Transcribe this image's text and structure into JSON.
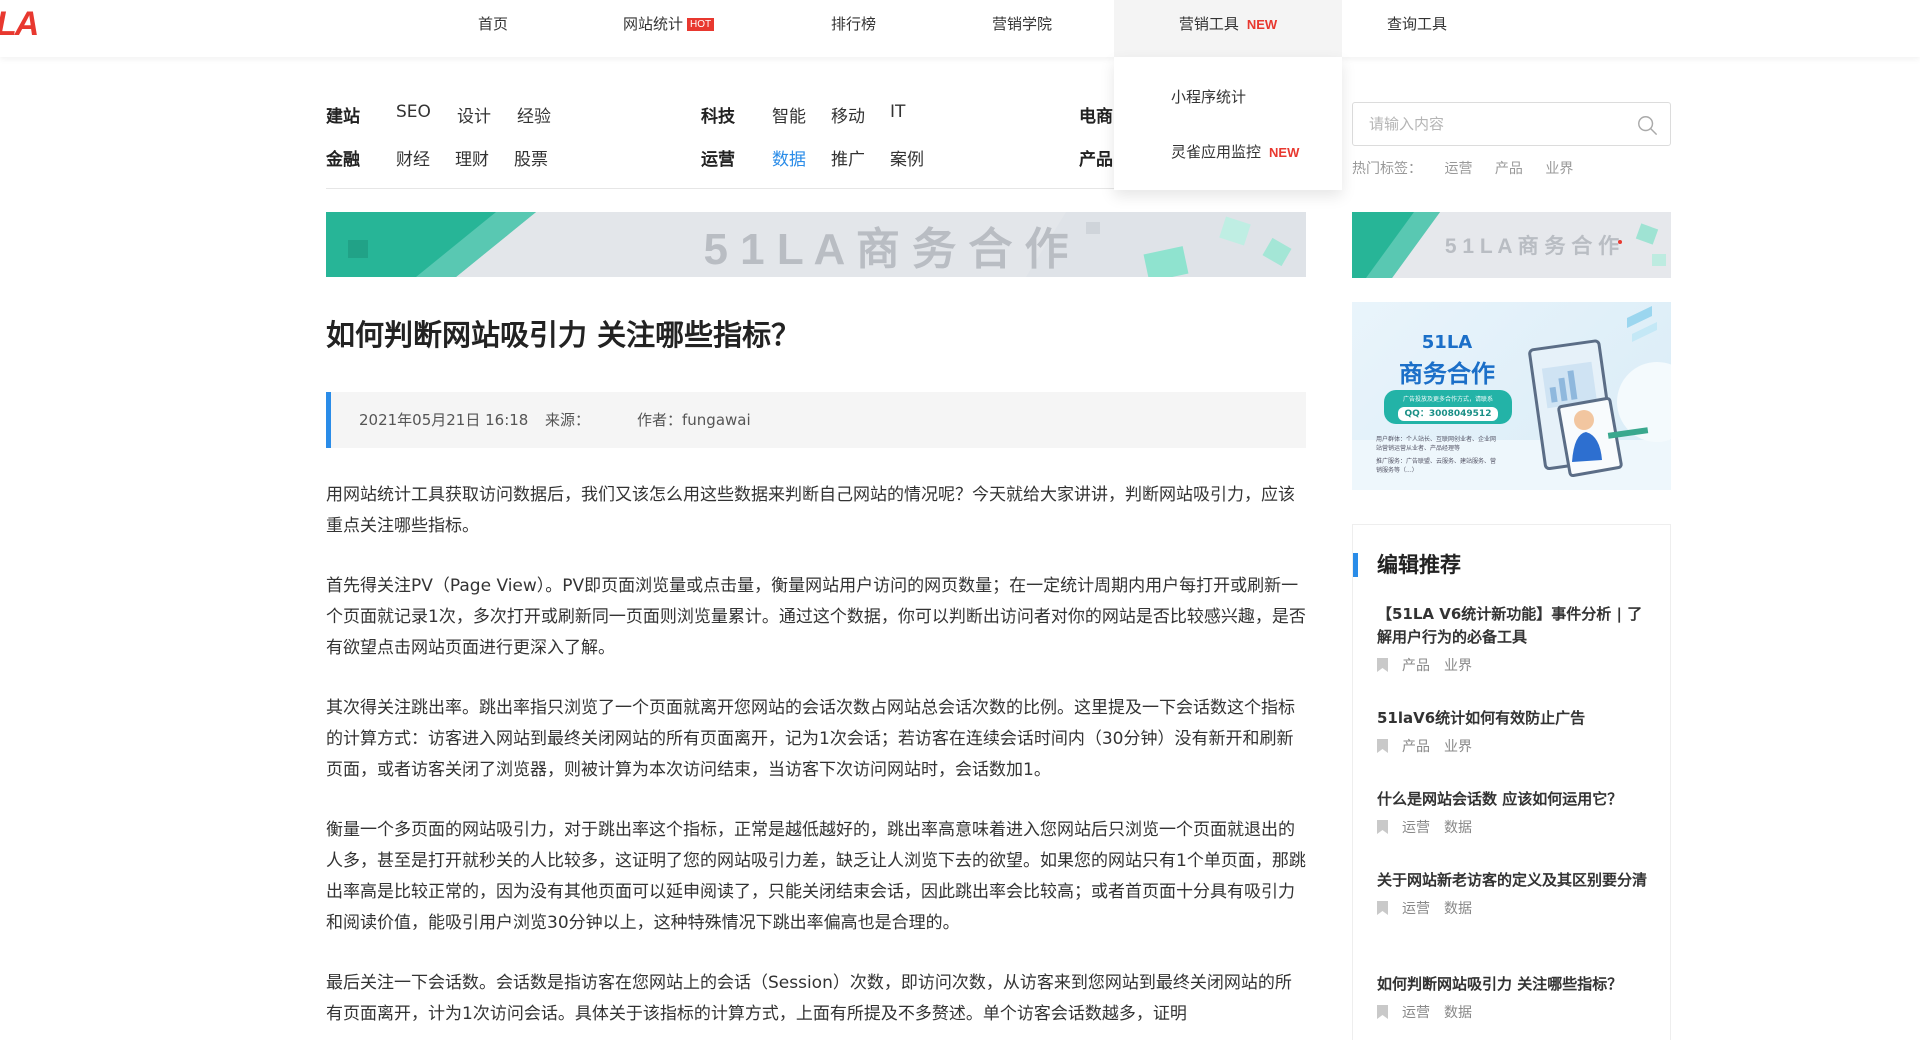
{
  "brand": {
    "logo_text": "LA",
    "color": "#e8382f"
  },
  "nav": {
    "items": [
      {
        "label": "首页"
      },
      {
        "label": "网站统计",
        "badge": "HOT"
      },
      {
        "label": "排行榜"
      },
      {
        "label": "营销学院"
      },
      {
        "label": "营销工具",
        "badge": "NEW"
      },
      {
        "label": "查询工具"
      }
    ],
    "dropdown": [
      {
        "label": "小程序统计"
      },
      {
        "label": "灵雀应用监控",
        "badge": "NEW"
      }
    ]
  },
  "categories": {
    "groups": [
      {
        "heads": [
          "建站",
          "金融"
        ],
        "rows": [
          [
            "SEO",
            "设计",
            "经验"
          ],
          [
            "财经",
            "理财",
            "股票"
          ]
        ]
      },
      {
        "heads": [
          "科技",
          "运营"
        ],
        "rows": [
          [
            "智能",
            "移动",
            "IT"
          ],
          [
            "数据",
            "推广",
            "案例"
          ]
        ]
      },
      {
        "heads": [
          "电商",
          "产品"
        ],
        "rows": [
          [],
          []
        ]
      }
    ],
    "current": "数据",
    "accent_color": "#2a8ce8"
  },
  "search": {
    "placeholder": "请输入内容",
    "hot_label": "热门标签：",
    "hot_tags": [
      "运营",
      "产品",
      "业界"
    ]
  },
  "banners": {
    "main_text": "5 1 L A 商 务 合 作",
    "side_text": "5 1 L A 商 务 合 作",
    "ad": {
      "title1": "51LA",
      "title2": "商务合作",
      "pill_line1": "广告投放及更多合作方式，请联系",
      "pill_line2": "QQ：3008049512",
      "small1": "用户群体：个人站长、互联网创业者、企业网",
      "small2": "站营销运营从业者、产品经理等",
      "small3": "推广服务：广告联盟、云服务、建站服务、营",
      "small4": "销服务等（...）"
    }
  },
  "article": {
    "title": "如何判断网站吸引力 关注哪些指标？",
    "date": "2021年05月21日 16:18",
    "source_label": "来源：",
    "author": "作者：fungawai",
    "paragraphs": [
      "用网站统计工具获取访问数据后，我们又该怎么用这些数据来判断自己网站的情况呢？今天就给大家讲讲，判断网站吸引力，应该重点关注哪些指标。",
      "首先得关注PV（Page View）。PV即页面浏览量或点击量，衡量网站用户访问的网页数量；在一定统计周期内用户每打开或刷新一个页面就记录1次，多次打开或刷新同一页面则浏览量累计。通过这个数据，你可以判断出访问者对你的网站是否比较感兴趣，是否有欲望点击网站页面进行更深入了解。",
      "其次得关注跳出率。跳出率指只浏览了一个页面就离开您网站的会话次数占网站总会话次数的比例。这里提及一下会话数这个指标的计算方式：访客进入网站到最终关闭网站的所有页面离开，记为1次会话；若访客在连续会话时间内（30分钟）没有新开和刷新页面，或者访客关闭了浏览器，则被计算为本次访问结束，当访客下次访问网站时，会话数加1。",
      "衡量一个多页面的网站吸引力，对于跳出率这个指标，正常是越低越好的，跳出率高意味着进入您网站后只浏览一个页面就退出的人多，甚至是打开就秒关的人比较多，这证明了您的网站吸引力差，缺乏让人浏览下去的欲望。如果您的网站只有1个单页面，那跳出率高是比较正常的，因为没有其他页面可以延申阅读了，只能关闭结束会话，因此跳出率会比较高；或者首页面十分具有吸引力和阅读价值，能吸引用户浏览30分钟以上，这种特殊情况下跳出率偏高也是合理的。",
      "最后关注一下会话数。会话数是指访客在您网站上的会话（Session）次数，即访问次数，从访客来到您网站到最终关闭网站的所有页面离开，计为1次访问会话。具体关于该指标的计算方式，上面有所提及不多赘述。单个访客会话数越多，证明"
    ]
  },
  "picks": {
    "header": "编辑推荐",
    "items": [
      {
        "title": "【51LA V6统计新功能】事件分析 | 了解用户行为的必备工具",
        "tags": [
          "产品",
          "业界"
        ]
      },
      {
        "title": "51laV6统计如何有效防止广告",
        "tags": [
          "产品",
          "业界"
        ]
      },
      {
        "title": "什么是网站会话数 应该如何运用它？",
        "tags": [
          "运营",
          "数据"
        ]
      },
      {
        "title": "关于网站新老访客的定义及其区别要分清",
        "tags": [
          "运营",
          "数据"
        ]
      },
      {
        "title": "如何判断网站吸引力 关注哪些指标？",
        "tags": [
          "运营",
          "数据"
        ]
      }
    ]
  }
}
